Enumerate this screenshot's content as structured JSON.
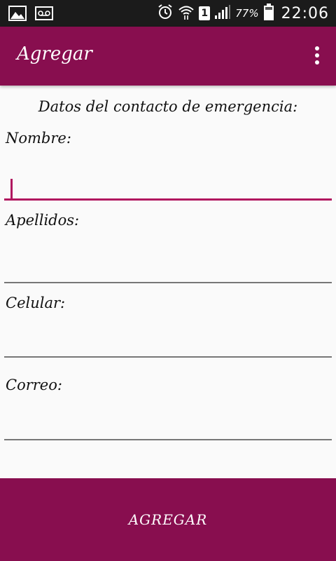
{
  "status_bar": {
    "icons_left": [
      "image-icon",
      "voicemail-icon"
    ],
    "icons_right": [
      "alarm-icon",
      "wifi-icon",
      "sim-icon",
      "signal-icon",
      "battery-icon"
    ],
    "sim_label": "1",
    "battery": "77%",
    "time": "22:06"
  },
  "appbar": {
    "title": "Agregar",
    "color": "#880e4f"
  },
  "form": {
    "heading": "Datos del contacto de emergencia:",
    "fields": [
      {
        "label": "Nombre:",
        "value": ""
      },
      {
        "label": "Apellidos:",
        "value": ""
      },
      {
        "label": "Celular:",
        "value": ""
      },
      {
        "label": "Correo:",
        "value": ""
      }
    ],
    "accent_color": "#b0175f"
  },
  "submit": {
    "label": "AGREGAR"
  }
}
